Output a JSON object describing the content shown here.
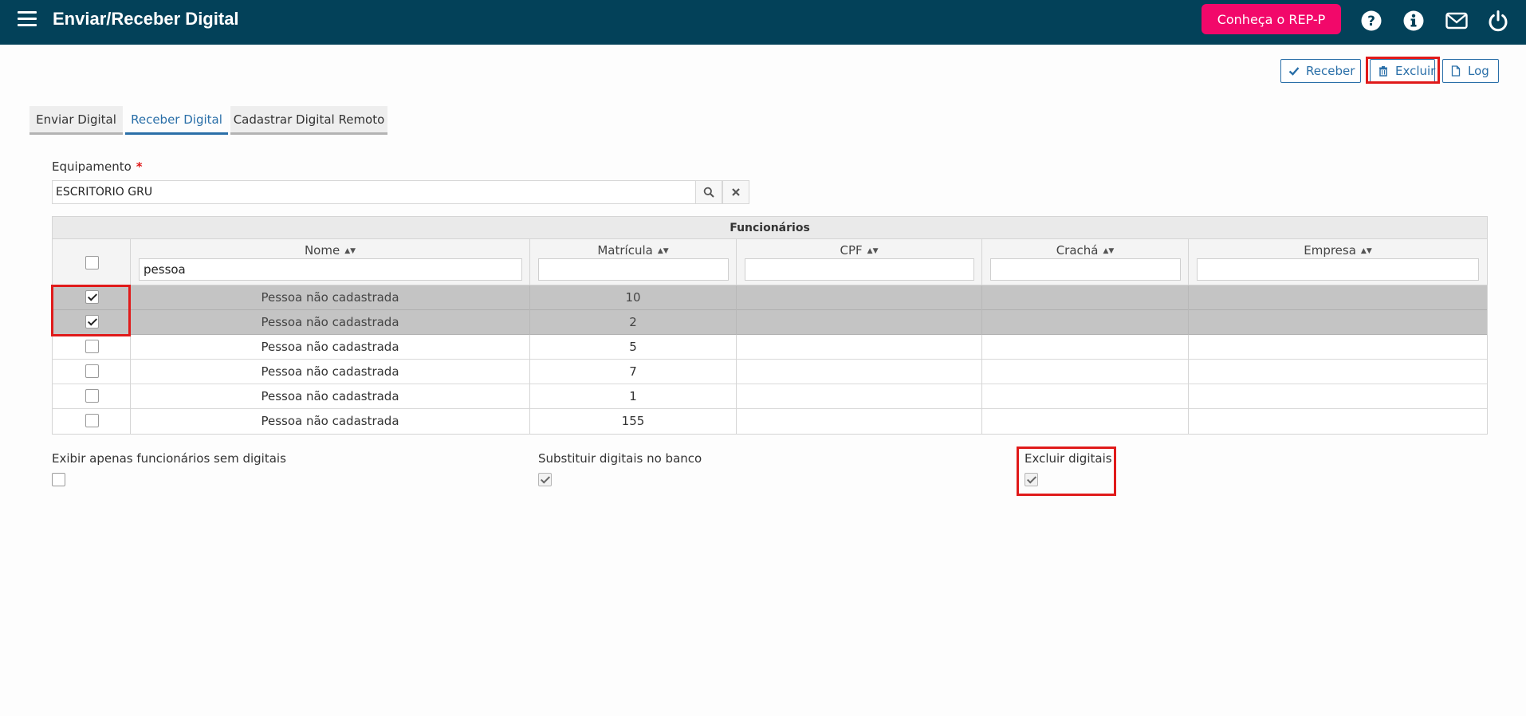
{
  "header": {
    "title": "Enviar/Receber Digital",
    "promo_label": "Conheça o REP-P",
    "icons": [
      "help-icon",
      "info-icon",
      "mail-icon",
      "power-icon"
    ],
    "bg_color": "#034159",
    "promo_color": "#f2086a"
  },
  "toolbar": {
    "receive_label": "Receber",
    "delete_label": "Excluir",
    "log_label": "Log"
  },
  "tabs": [
    {
      "label": "Enviar Digital",
      "active": false
    },
    {
      "label": "Receber Digital",
      "active": true
    },
    {
      "label": "Cadastrar Digital Remoto",
      "active": false
    }
  ],
  "equipment": {
    "label": "Equipamento",
    "required_mark": "*",
    "value": "ESCRITÓRIO GRU"
  },
  "table": {
    "title": "Funcionários",
    "columns": [
      "Nome",
      "Matrícula",
      "CPF",
      "Crachá",
      "Empresa"
    ],
    "filters": {
      "nome": "pessoa",
      "matricula": "",
      "cpf": "",
      "cracha": "",
      "empresa": ""
    },
    "rows": [
      {
        "checked": true,
        "nome": "Pessoa não cadastrada",
        "matricula": "10",
        "cpf": "",
        "cracha": "",
        "empresa": ""
      },
      {
        "checked": true,
        "nome": "Pessoa não cadastrada",
        "matricula": "2",
        "cpf": "",
        "cracha": "",
        "empresa": ""
      },
      {
        "checked": false,
        "nome": "Pessoa não cadastrada",
        "matricula": "5",
        "cpf": "",
        "cracha": "",
        "empresa": ""
      },
      {
        "checked": false,
        "nome": "Pessoa não cadastrada",
        "matricula": "7",
        "cpf": "",
        "cracha": "",
        "empresa": ""
      },
      {
        "checked": false,
        "nome": "Pessoa não cadastrada",
        "matricula": "1",
        "cpf": "",
        "cracha": "",
        "empresa": ""
      },
      {
        "checked": false,
        "nome": "Pessoa não cadastrada",
        "matricula": "155",
        "cpf": "",
        "cracha": "",
        "empresa": ""
      }
    ]
  },
  "options": {
    "only_without_prints": {
      "label": "Exibir apenas funcionários sem digitais",
      "checked": false
    },
    "replace_in_db": {
      "label": "Substituir digitais no banco",
      "checked": true
    },
    "delete_prints": {
      "label": "Excluir digitais",
      "checked": true
    }
  }
}
